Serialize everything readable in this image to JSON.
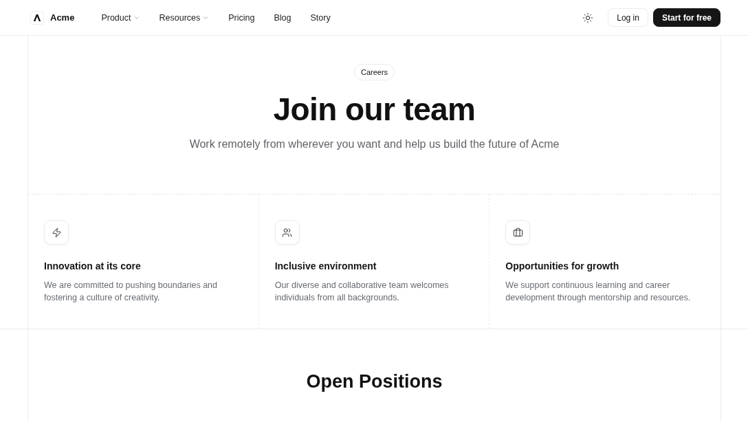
{
  "header": {
    "brand": "Acme",
    "nav": [
      {
        "label": "Product",
        "has_menu": true
      },
      {
        "label": "Resources",
        "has_menu": true
      },
      {
        "label": "Pricing",
        "has_menu": false
      },
      {
        "label": "Blog",
        "has_menu": false
      },
      {
        "label": "Story",
        "has_menu": false
      }
    ],
    "login": "Log in",
    "signup": "Start for free"
  },
  "hero": {
    "badge": "Careers",
    "title": "Join our team",
    "subtitle": "Work remotely from wherever you want and help us build the future of Acme"
  },
  "features": [
    {
      "title": "Innovation at its core",
      "description": "We are committed to pushing boundaries and fostering a culture of creativity."
    },
    {
      "title": "Inclusive environment",
      "description": "Our diverse and collaborative team welcomes individuals from all backgrounds."
    },
    {
      "title": "Opportunities for growth",
      "description": "We support continuous learning and career development through mentorship and resources."
    }
  ],
  "open_positions": {
    "title": "Open Positions"
  }
}
